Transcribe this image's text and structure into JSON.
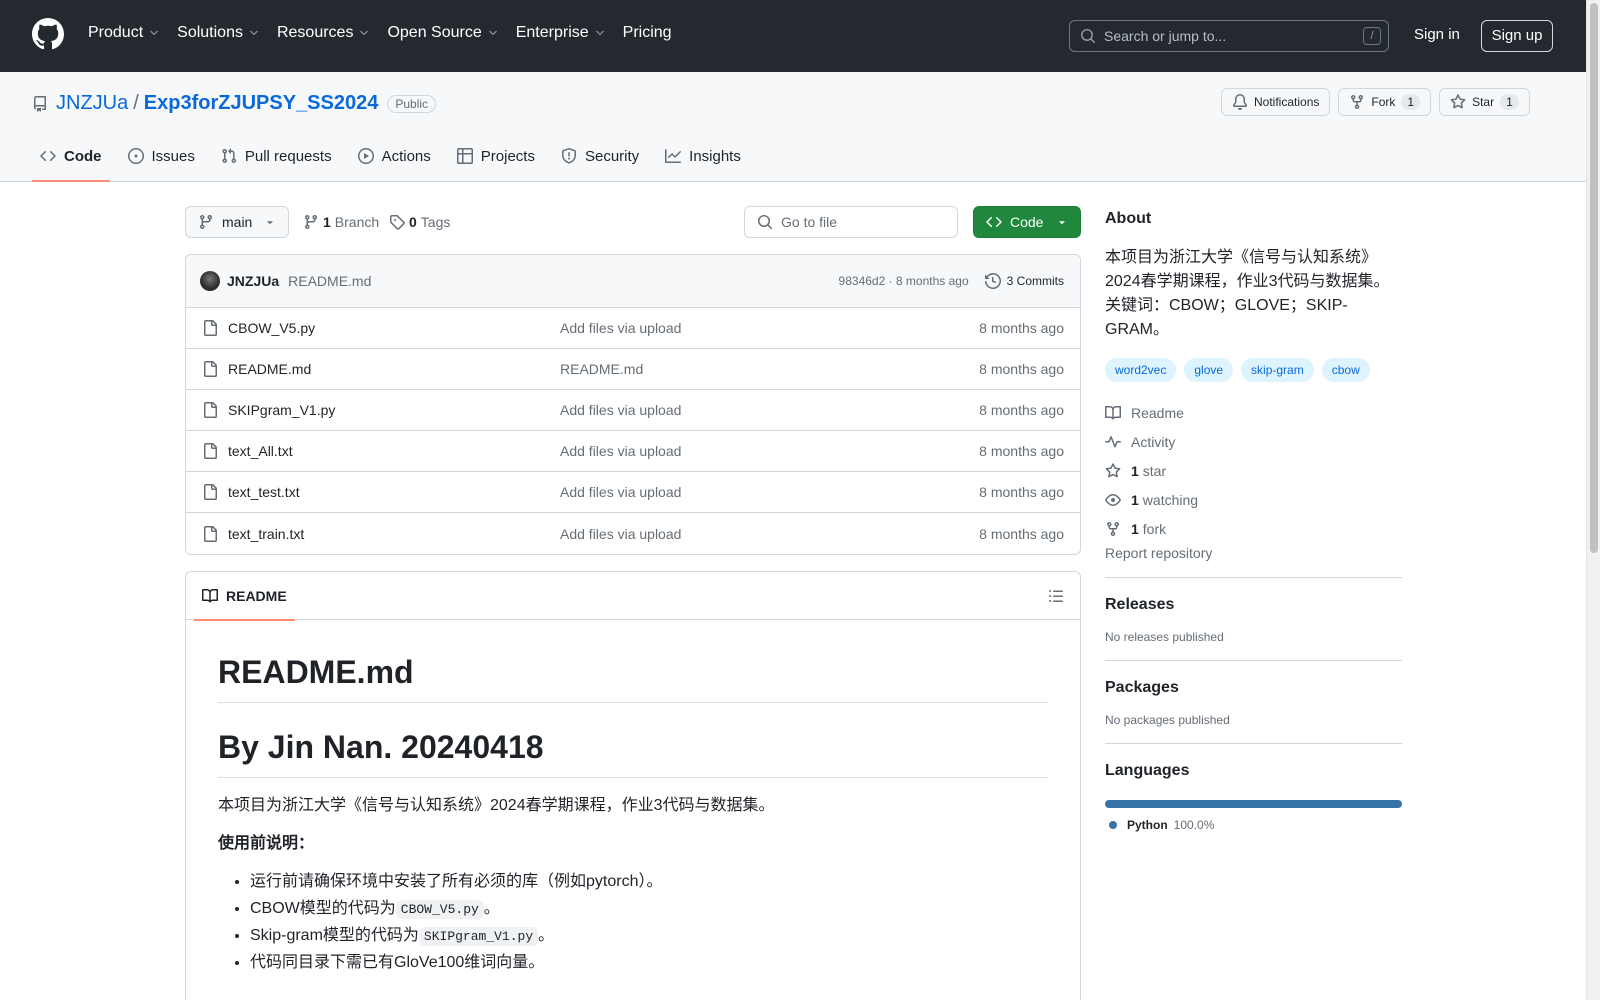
{
  "header": {
    "nav": [
      "Product",
      "Solutions",
      "Resources",
      "Open Source",
      "Enterprise",
      "Pricing"
    ],
    "search_placeholder": "Search or jump to...",
    "search_shortcut": "/",
    "signin": "Sign in",
    "signup": "Sign up"
  },
  "repo": {
    "owner": "JNZJUa",
    "separator": "/",
    "name": "Exp3forZJUPSY_SS2024",
    "visibility": "Public",
    "notifications": "Notifications",
    "fork_label": "Fork",
    "fork_count": "1",
    "star_label": "Star",
    "star_count": "1",
    "tabs": [
      "Code",
      "Issues",
      "Pull requests",
      "Actions",
      "Projects",
      "Security",
      "Insights"
    ]
  },
  "toolbar": {
    "branch": "main",
    "branch_count": "1",
    "branch_label": "Branch",
    "tag_count": "0",
    "tag_label": "Tags",
    "goto_placeholder": "Go to file",
    "code_button": "Code"
  },
  "commit": {
    "author": "JNZJUa",
    "message": "README.md",
    "meta": "98346d2 · 8 months ago",
    "commits_label": "3 Commits"
  },
  "files": [
    {
      "name": "CBOW_V5.py",
      "message": "Add files via upload",
      "time": "8 months ago"
    },
    {
      "name": "README.md",
      "message": "README.md",
      "time": "8 months ago"
    },
    {
      "name": "SKIPgram_V1.py",
      "message": "Add files via upload",
      "time": "8 months ago"
    },
    {
      "name": "text_All.txt",
      "message": "Add files via upload",
      "time": "8 months ago"
    },
    {
      "name": "text_test.txt",
      "message": "Add files via upload",
      "time": "8 months ago"
    },
    {
      "name": "text_train.txt",
      "message": "Add files via upload",
      "time": "8 months ago"
    }
  ],
  "readme": {
    "tab_label": "README",
    "h1": "README.md",
    "h1_second": "By Jin Nan. 20240418",
    "intro": "本项目为浙江大学《信号与认知系统》2024春学期课程，作业3代码与数据集。",
    "usage_title": "使用前说明：",
    "items": [
      {
        "text": "运行前请确保环境中安装了所有必须的库（例如pytorch）。"
      },
      {
        "pre": "CBOW模型的代码为",
        "code": "CBOW_V5.py",
        "post": "。"
      },
      {
        "pre": "Skip-gram模型的代码为",
        "code": "SKIPgram_V1.py",
        "post": "。"
      },
      {
        "text": "代码同目录下需已有GloVe100维词向量。"
      }
    ]
  },
  "about": {
    "title": "About",
    "description": "本项目为浙江大学《信号与认知系统》2024春学期课程，作业3代码与数据集。关键词：CBOW；GLOVE；SKIP-GRAM。",
    "topics": [
      "word2vec",
      "glove",
      "skip-gram",
      "cbow"
    ],
    "readme": "Readme",
    "activity": "Activity",
    "stars_num": "1",
    "stars_label": "star",
    "watching_num": "1",
    "watching_label": "watching",
    "fork_num": "1",
    "fork_label": "fork",
    "report": "Report repository"
  },
  "releases": {
    "title": "Releases",
    "empty": "No releases published"
  },
  "packages": {
    "title": "Packages",
    "empty": "No packages published"
  },
  "languages": {
    "title": "Languages",
    "name": "Python",
    "percent": "100.0%",
    "color": "#3572A5"
  }
}
